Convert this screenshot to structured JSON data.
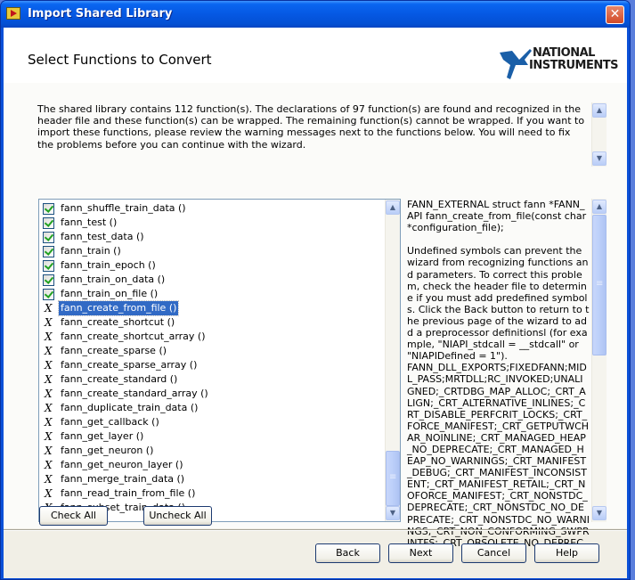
{
  "window": {
    "title": "Import Shared Library",
    "close_glyph": "✕"
  },
  "header": {
    "page_title": "Select Functions to Convert",
    "logo_line1": "NATIONAL",
    "logo_line2": "INSTRUMENTS",
    "logo_tm": "™",
    "brand_color": "#1a5fa8"
  },
  "intro_text": "The shared library contains 112 function(s). The declarations of 97 function(s) are found and recognized in the header file and these function(s) can be wrapped. The remaining function(s) cannot be wrapped. If you want to import these functions, please review the warning messages next to the functions below. You will need to fix the problems before you can continue with the wizard.",
  "functions": [
    {
      "name": "fann_shuffle_train_data ()",
      "status": "checked",
      "selected": false
    },
    {
      "name": "fann_test ()",
      "status": "checked",
      "selected": false
    },
    {
      "name": "fann_test_data ()",
      "status": "checked",
      "selected": false
    },
    {
      "name": "fann_train ()",
      "status": "checked",
      "selected": false
    },
    {
      "name": "fann_train_epoch ()",
      "status": "checked",
      "selected": false
    },
    {
      "name": "fann_train_on_data ()",
      "status": "checked",
      "selected": false
    },
    {
      "name": "fann_train_on_file ()",
      "status": "checked",
      "selected": false
    },
    {
      "name": "fann_create_from_file ()",
      "status": "error",
      "selected": true
    },
    {
      "name": "fann_create_shortcut ()",
      "status": "error",
      "selected": false
    },
    {
      "name": "fann_create_shortcut_array ()",
      "status": "error",
      "selected": false
    },
    {
      "name": "fann_create_sparse ()",
      "status": "error",
      "selected": false
    },
    {
      "name": "fann_create_sparse_array ()",
      "status": "error",
      "selected": false
    },
    {
      "name": "fann_create_standard ()",
      "status": "error",
      "selected": false
    },
    {
      "name": "fann_create_standard_array ()",
      "status": "error",
      "selected": false
    },
    {
      "name": "fann_duplicate_train_data ()",
      "status": "error",
      "selected": false
    },
    {
      "name": "fann_get_callback ()",
      "status": "error",
      "selected": false
    },
    {
      "name": "fann_get_layer ()",
      "status": "error",
      "selected": false
    },
    {
      "name": "fann_get_neuron ()",
      "status": "error",
      "selected": false
    },
    {
      "name": "fann_get_neuron_layer ()",
      "status": "error",
      "selected": false
    },
    {
      "name": "fann_merge_train_data ()",
      "status": "error",
      "selected": false
    },
    {
      "name": "fann_read_train_from_file ()",
      "status": "error",
      "selected": false
    },
    {
      "name": "fann_subset_train_data ()",
      "status": "error",
      "selected": false
    }
  ],
  "error_glyph": "X",
  "detail": {
    "text": "FANN_EXTERNAL struct fann *FANN_API fann_create_from_file(const char *configuration_file);\n\nUndefined symbols can prevent the wizard from recognizing functions and parameters. To correct this problem, check the header file to determine if you must add predefined symbols. Click the Back button to return to the previous page of the wizard to add a preprocessor definitionsl (for example, \"NIAPI_stdcall = __stdcall\" or \"NIAPIDefined = 1\").\nFANN_DLL_EXPORTS;FIXEDFANN;MIDL_PASS;MRTDLL;RC_INVOKED;UNALIGNED;_CRTDBG_MAP_ALLOC;_CRT_ALIGN;_CRT_ALTERNATIVE_INLINES;_CRT_DISABLE_PERFCRIT_LOCKS;_CRT_FORCE_MANIFEST;_CRT_GETPUTWCHAR_NOINLINE;_CRT_MANAGED_HEAP_NO_DEPRECATE;_CRT_MANAGED_HEAP_NO_WARNINGS;_CRT_MANIFEST_DEBUG;_CRT_MANIFEST_INCONSISTENT;_CRT_MANIFEST_RETAIL;_CRT_NOFORCE_MANIFEST;_CRT_NONSTDC_DEPRECATE;_CRT_NONSTDC_NO_DEPRECATE;_CRT_NONSTDC_NO_WARNINGS;_CRT_NON_CONFORMING_SWPRINTFS;_CRT_OBSOLETE_NO_DEPRECATE;_"
  },
  "scroll": {
    "up_glyph": "▲",
    "down_glyph": "▼"
  },
  "buttons": {
    "check_all": "Check All",
    "uncheck_all": "Uncheck All",
    "back": "Back",
    "next": "Next",
    "cancel": "Cancel",
    "help": "Help"
  }
}
